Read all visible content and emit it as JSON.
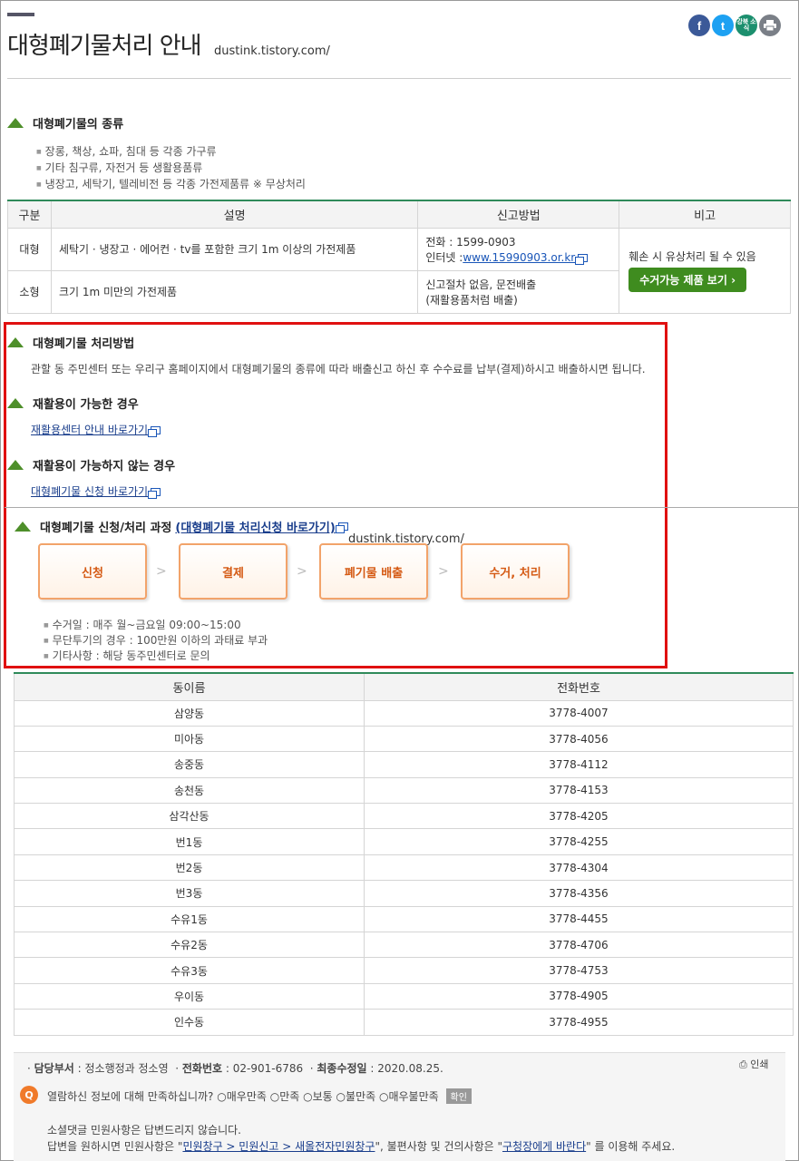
{
  "header": {
    "title": "대형폐기물처리 안내",
    "url": "dustink.tistory.com/",
    "share": {
      "facebook": "f",
      "twitter": "t",
      "gangbuk": "강북 소식"
    }
  },
  "types": {
    "heading": "대형폐기물의 종류",
    "items": [
      "장롱, 책상, 쇼파, 침대 등 각종 가구류",
      "기타 침구류, 자전거 등 생활용품류",
      "냉장고, 세탁기, 텔레비전 등 각종 가전제품류 ※ 무상처리"
    ]
  },
  "table1": {
    "headers": [
      "구분",
      "설명",
      "신고방법",
      "비고"
    ],
    "row1": {
      "kind": "대형",
      "desc": "세탁기 · 냉장고 · 에어컨 · tv를 포함한 크기 1m 이상의 가전제품",
      "phone": "전화 : 1599-0903",
      "internet_label": "인터넷 :",
      "internet_link": "www.15990903.or.kr"
    },
    "row2": {
      "kind": "소형",
      "desc": "크기 1m 미만의 가전제품",
      "method1": "신고절차 없음, 문전배출",
      "method2": "(재활용품처럼 배출)"
    },
    "note": "훼손 시 유상처리 될 수 있음",
    "button": "수거가능 제품 보기"
  },
  "method": {
    "heading": "대형폐기물 처리방법",
    "desc": "관할 동 주민센터 또는 우리구 홈페이지에서 대형폐기물의 종류에 따라 배출신고 하신 후 수수료를 납부(결제)하시고 배출하시면 됩니다."
  },
  "recyclable": {
    "heading": "재활용이 가능한 경우",
    "link": "재활용센터 안내 바로가기"
  },
  "non_recyclable": {
    "heading": "재활용이 가능하지 않는 경우",
    "link": "대형폐기물 신청 바로가기"
  },
  "process": {
    "heading": "대형폐기물 신청/처리 과정",
    "link": "(대형폐기물 처리신청 바로가기)",
    "watermark": "dustink.tistory.com/",
    "steps": [
      "신청",
      "결제",
      "폐기물 배출",
      "수거, 처리"
    ],
    "notes": [
      "수거일 : 매주 월~금요일 09:00~15:00",
      "무단투기의 경우 : 100만원 이하의 과태료 부과",
      "기타사항 : 해당 동주민센터로 문의"
    ]
  },
  "table2": {
    "headers": [
      "동이름",
      "전화번호"
    ],
    "rows": [
      [
        "삼양동",
        "3778-4007"
      ],
      [
        "미아동",
        "3778-4056"
      ],
      [
        "송중동",
        "3778-4112"
      ],
      [
        "송천동",
        "3778-4153"
      ],
      [
        "삼각산동",
        "3778-4205"
      ],
      [
        "번1동",
        "3778-4255"
      ],
      [
        "번2동",
        "3778-4304"
      ],
      [
        "번3동",
        "3778-4356"
      ],
      [
        "수유1동",
        "3778-4455"
      ],
      [
        "수유2동",
        "3778-4706"
      ],
      [
        "수유3동",
        "3778-4753"
      ],
      [
        "우이동",
        "3778-4905"
      ],
      [
        "인수동",
        "3778-4955"
      ]
    ]
  },
  "footer": {
    "dept_label": "담당부서",
    "dept": "정소행정과 정소영",
    "phone_label": "전화번호",
    "phone": "02-901-6786",
    "updated_label": "최종수정일",
    "updated": "2020.08.25.",
    "print": "인쇄",
    "q_icon": "Q",
    "survey_q": "열람하신 정보에 대해 만족하십니까?",
    "options": [
      "매우만족",
      "만족",
      "보통",
      "불만족",
      "매우불만족"
    ],
    "confirm": "확인",
    "line1": "소셜댓글 민원사항은 답변드리지 않습니다.",
    "line2_a": "답변을 원하시면 민원사항은 \"",
    "line2_link1": "민원창구 > 민원신고 > 새올전자민원창구",
    "line2_b": "\", 불편사항 및 건의사항은 \"",
    "line2_link2": "구청장에게 바란다",
    "line2_c": "\" 를 이용해 주세요."
  }
}
